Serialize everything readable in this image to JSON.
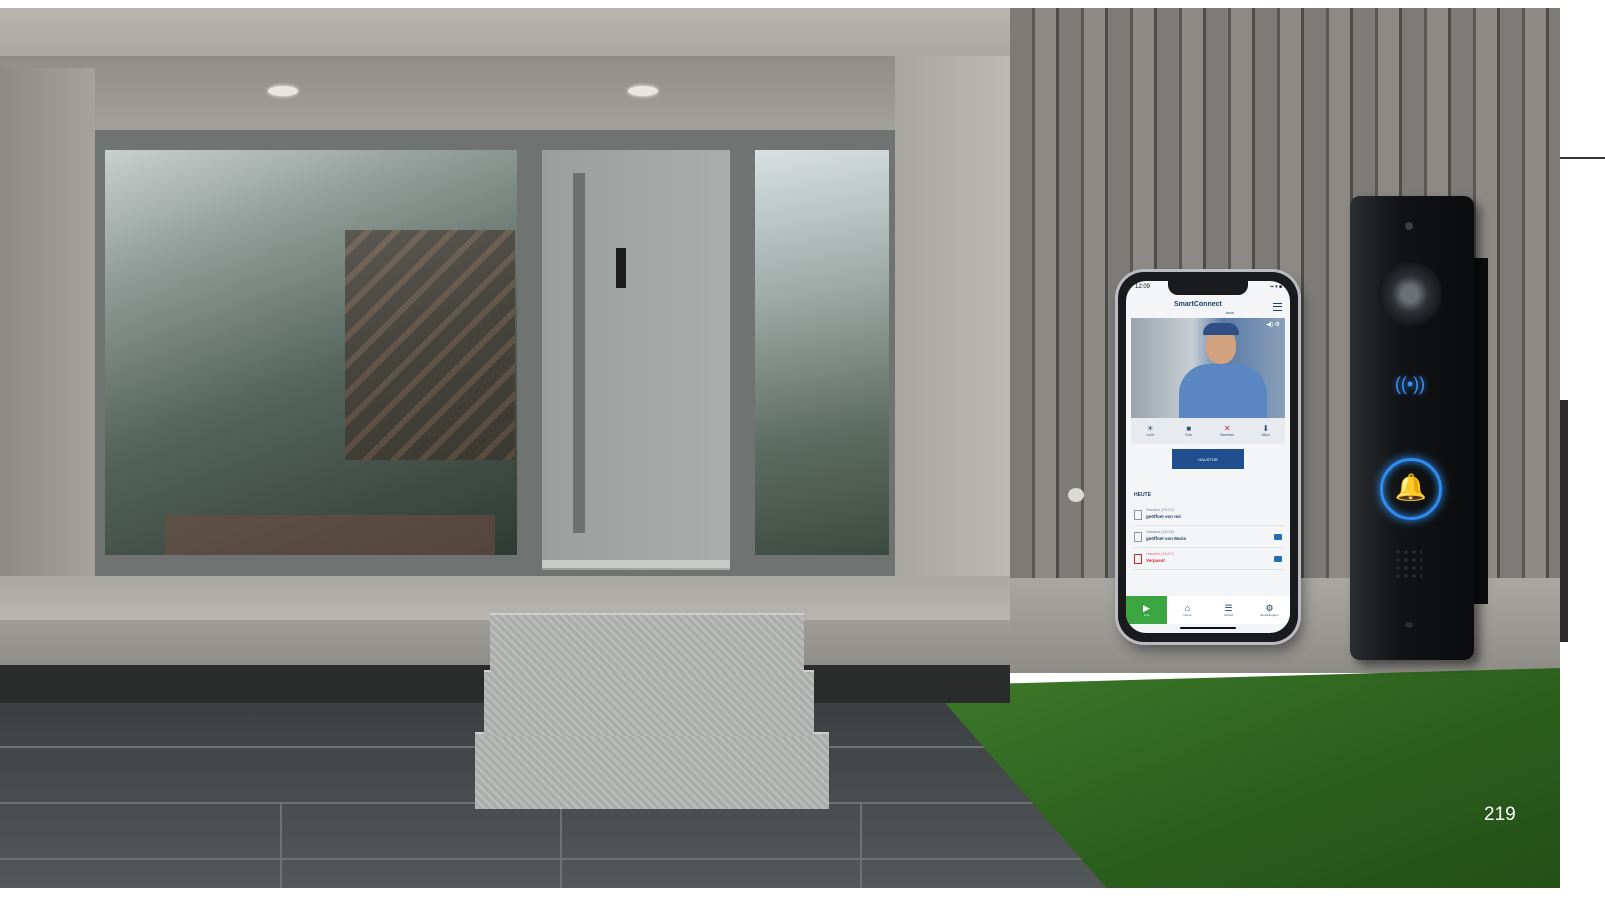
{
  "page": {
    "number": "219"
  },
  "phone_app": {
    "status_time": "12:09",
    "status_icons": "▪▪ ▾ ■",
    "brand_name": "SmartConnect",
    "brand_sub": "door",
    "controls": [
      {
        "icon": "☀",
        "label": "Licht",
        "icon_name": "light-icon"
      },
      {
        "icon": "■",
        "label": "Foto",
        "icon_name": "camera-icon"
      },
      {
        "icon": "✕",
        "label": "Beenden",
        "icon_name": "hang-up-icon"
      },
      {
        "icon": "⬇",
        "label": "Mikro",
        "icon_name": "mic-icon"
      }
    ],
    "open_button": "HAUSTÜR",
    "section_title": "HEUTE",
    "events": [
      {
        "line1": "Haustür  (15:27)",
        "line2": "geöffnet von mir",
        "missed": false
      },
      {
        "line1": "Haustür  (15:13)",
        "line2": "geöffnet von Mario",
        "missed": false
      },
      {
        "line1": "Haustür  (15:07)",
        "line2": "Verpasst",
        "missed": true
      }
    ],
    "tabs": [
      {
        "icon": "▶",
        "label": "Live",
        "active": true,
        "icon_name": "video-icon"
      },
      {
        "icon": "⌂",
        "label": "Home",
        "active": false,
        "icon_name": "home-icon"
      },
      {
        "icon": "☰",
        "label": "Verlauf",
        "active": false,
        "icon_name": "list-icon"
      },
      {
        "icon": "⚙",
        "label": "Einstellungen",
        "active": false,
        "icon_name": "gear-icon"
      }
    ],
    "colors": {
      "brand": "#1e3f6b",
      "accent": "#1f4f8e",
      "live_tab": "#3aa541",
      "missed": "#d02a2a"
    }
  },
  "doorbell": {
    "rfid_icon": "((•))",
    "bell_icon": "🔔",
    "glow_color": "#2f8cf0"
  }
}
